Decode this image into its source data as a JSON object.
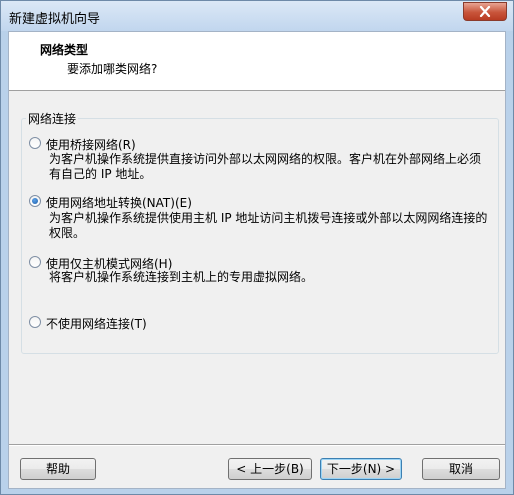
{
  "window": {
    "title": "新建虚拟机向导"
  },
  "header": {
    "title": "网络类型",
    "subtitle": "要添加哪类网络?"
  },
  "group": {
    "label": "网络连接",
    "options": [
      {
        "label": "使用桥接网络(R)",
        "description": "为客户机操作系统提供直接访问外部以太网网络的权限。客户机在外部网络上必须有自己的 IP 地址。",
        "checked": false
      },
      {
        "label": "使用网络地址转换(NAT)(E)",
        "description": "为客户机操作系统提供使用主机 IP 地址访问主机拨号连接或外部以太网网络连接的权限。",
        "checked": true
      },
      {
        "label": "使用仅主机模式网络(H)",
        "description": "将客户机操作系统连接到主机上的专用虚拟网络。",
        "checked": false
      },
      {
        "label": "不使用网络连接(T)",
        "description": "",
        "checked": false
      }
    ]
  },
  "buttons": {
    "help": "帮助",
    "back": "< 上一步(B)",
    "next": "下一步(N) >",
    "cancel": "取消"
  }
}
